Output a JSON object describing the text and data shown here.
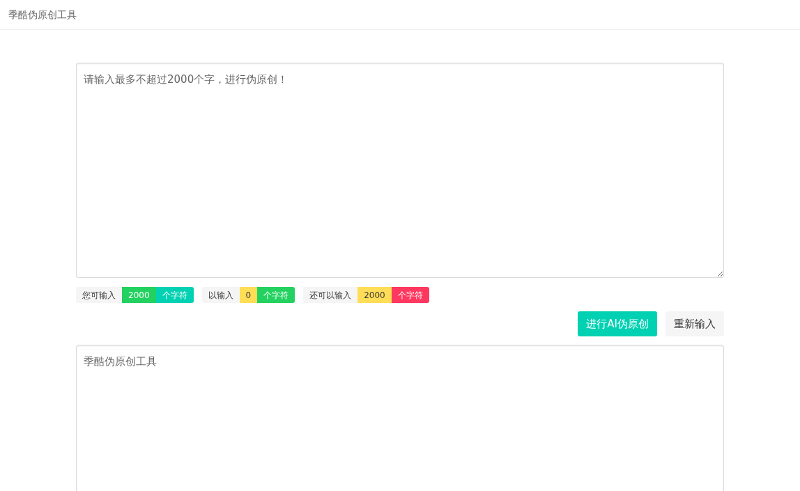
{
  "header": {
    "title": "季酷伪原创工具"
  },
  "input": {
    "placeholder": "请输入最多不超过2000个字，进行伪原创！"
  },
  "counters": [
    {
      "label": "您可输入",
      "value": {
        "text": "2000",
        "color": "#23d160"
      },
      "unit": {
        "text": "个字符",
        "color": "#00d1b2"
      }
    },
    {
      "label": "以输入",
      "value": {
        "text": "0",
        "color": "#ffdd57"
      },
      "unit": {
        "text": "个字符",
        "color": "#23d160"
      }
    },
    {
      "label": "还可以输入",
      "value": {
        "text": "2000",
        "color": "#ffdd57"
      },
      "unit": {
        "text": "个字符",
        "color": "#ff3860"
      }
    }
  ],
  "buttons": [
    {
      "label": "进行AI伪原创",
      "kind": "primary"
    },
    {
      "label": "重新输入",
      "kind": "default"
    }
  ],
  "output": {
    "value": "季酷伪原创工具"
  }
}
